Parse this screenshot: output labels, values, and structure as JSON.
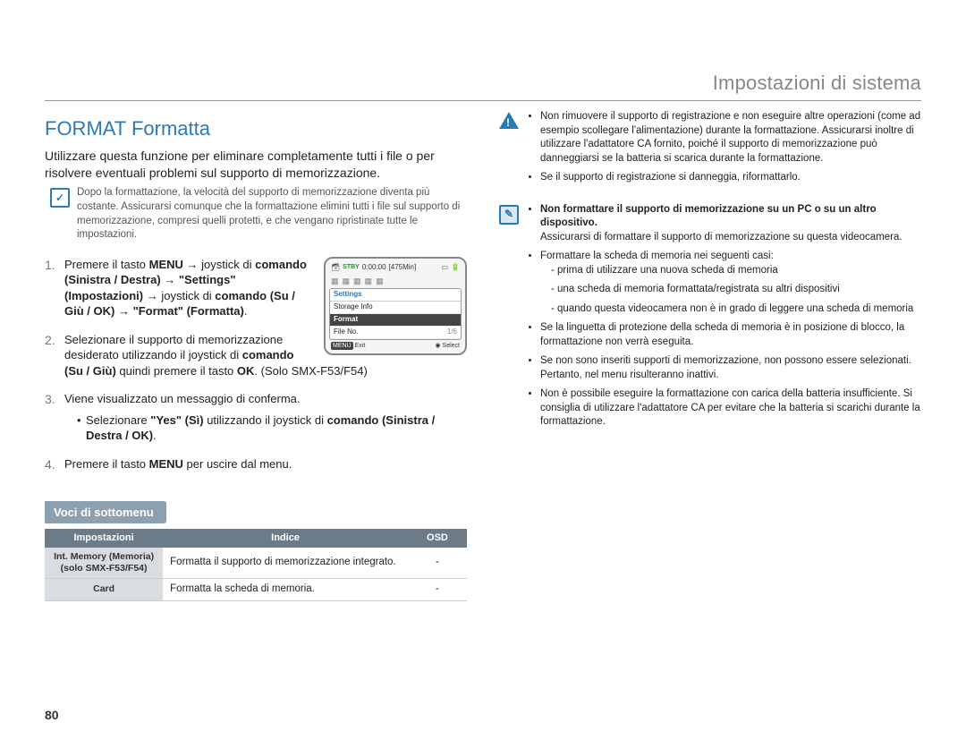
{
  "header": {
    "title": "Impostazioni di sistema"
  },
  "page_number": "80",
  "left": {
    "section_title": "FORMAT Formatta",
    "intro": "Utilizzare questa funzione per eliminare completamente tutti i file o per risolvere eventuali problemi sul supporto di memorizzazione.",
    "note": "Dopo la formattazione, la velocità del supporto di memorizzazione diventa più costante. Assicurarsi comunque che la formattazione elimini tutti i file sul supporto di memorizzazione, compresi quelli protetti, e che vengano ripristinate tutte le impostazioni.",
    "steps": {
      "s1_a": "Premere il tasto ",
      "s1_b": "MENU",
      "s1_c": " → joystick di ",
      "s1_d": "comando (Sinistra / Destra)",
      "s1_e": " → ",
      "s1_f": "\"Settings\" (Impostazioni)",
      "s1_g": " → joystick di ",
      "s1_h": "comando (Su / Giù / OK)",
      "s1_i": " → ",
      "s1_j": "\"Format\" (Formatta)",
      "s1_k": ".",
      "s2_a": "Selezionare il supporto di memorizzazione desiderato utilizzando il joystick di ",
      "s2_b": "comando (Su / Giù)",
      "s2_c": " quindi premere il tasto ",
      "s2_d": "OK",
      "s2_e": ". (Solo SMX-F53/F54)",
      "s3_a": "Viene visualizzato un messaggio di conferma.",
      "s3_bullet_a": "Selezionare ",
      "s3_bullet_b": "\"Yes\" (Sì)",
      "s3_bullet_c": " utilizzando il joystick di ",
      "s3_bullet_d": "comando (Sinistra / Destra / OK)",
      "s3_bullet_e": ".",
      "s4_a": "Premere il tasto ",
      "s4_b": "MENU",
      "s4_c": " per uscire dal menu."
    },
    "screen": {
      "stby": "STBY",
      "time": "0:00:00",
      "remain": "[475Min]",
      "menu_title": "Settings",
      "items": [
        "Storage Info",
        "Format",
        "File No."
      ],
      "selected_index": 1,
      "bottom_left_badge": "MENU",
      "bottom_left": "Exit",
      "bottom_right": "Select",
      "page_indicator": "1/6"
    },
    "subsection": "Voci di sottomenu",
    "table": {
      "headers": [
        "Impostazioni",
        "Indice",
        "OSD"
      ],
      "rows": [
        {
          "setting": "Int. Memory (Memoria) (solo SMX-F53/F54)",
          "desc": "Formatta il supporto di memorizzazione integrato.",
          "osd": "-"
        },
        {
          "setting": "Card",
          "desc": "Formatta la scheda di memoria.",
          "osd": "-"
        }
      ]
    }
  },
  "right": {
    "warn": [
      "Non rimuovere il supporto di registrazione e non eseguire altre operazioni (come ad esempio scollegare l'alimentazione) durante la formattazione. Assicurarsi inoltre di utilizzare l'adattatore CA fornito, poiché il supporto di memorizzazione può danneggiarsi se la batteria si scarica durante la formattazione.",
      "Se il supporto di registrazione si danneggia, riformattarlo."
    ],
    "info_bold": "Non formattare il supporto di memorizzazione su un PC o su un altro dispositivo.",
    "info_bold_cont": "Assicurarsi di formattare il supporto di memorizzazione su questa videocamera.",
    "info": [
      "Formattare la scheda di memoria nei seguenti casi:"
    ],
    "info_sub": [
      "prima di utilizzare una nuova scheda di memoria",
      "una scheda di memoria formattata/registrata su altri dispositivi",
      "quando questa videocamera non è in grado di leggere una scheda di memoria"
    ],
    "info_tail": [
      "Se la linguetta di protezione della scheda di memoria è in posizione di blocco, la formattazione non verrà eseguita.",
      "Se non sono inseriti supporti di memorizzazione, non possono essere selezionati. Pertanto, nel menu risulteranno inattivi.",
      "Non è possibile eseguire la formattazione con carica della batteria insufficiente. Si consiglia di utilizzare l'adattatore CA per evitare che la batteria si scarichi durante la formattazione."
    ]
  }
}
